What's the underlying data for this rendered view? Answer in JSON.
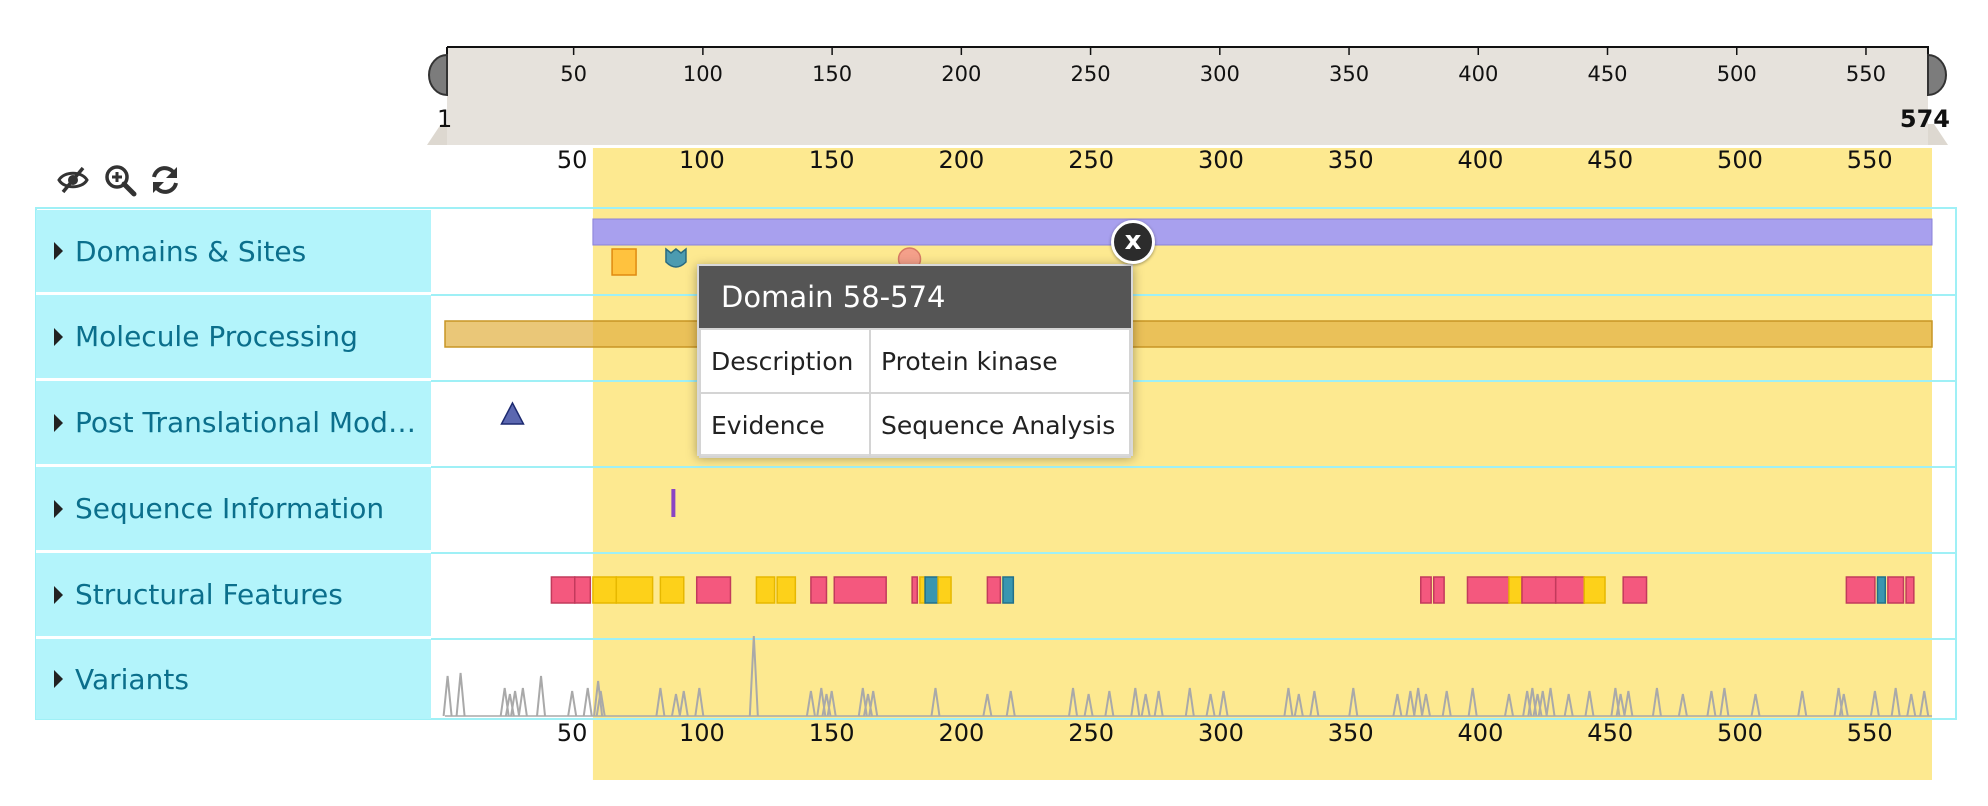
{
  "navigation": {
    "seq_length": 574,
    "start_label": "1",
    "end_label": "574",
    "tick_values": [
      50,
      100,
      150,
      200,
      250,
      300,
      350,
      400,
      450,
      500,
      550
    ],
    "zoom_range": [
      58,
      574
    ]
  },
  "toolbar": {
    "hide_icon": "eye-slash-icon",
    "zoom_icon": "zoom-in-icon",
    "reset_icon": "refresh-icon"
  },
  "categories": [
    {
      "label": "Domains & Sites"
    },
    {
      "label": "Molecule Processing"
    },
    {
      "label": "Post Translational Mod…"
    },
    {
      "label": "Sequence Information"
    },
    {
      "label": "Structural Features"
    },
    {
      "label": "Variants"
    }
  ],
  "features": {
    "domain": {
      "start": 58,
      "end": 574
    },
    "site_square": {
      "pos": 70
    },
    "site_shield": {
      "pos": 90
    },
    "site_circle": {
      "pos": 180
    },
    "chain": {
      "start": 1,
      "end": 574
    },
    "ptm_triangle": {
      "pos": 27
    },
    "seq_info_bar": {
      "pos": 89
    },
    "structural": [
      {
        "start": 42,
        "end": 51,
        "kind": "helix"
      },
      {
        "start": 51,
        "end": 57,
        "kind": "helix"
      },
      {
        "start": 58,
        "end": 67,
        "kind": "strand"
      },
      {
        "start": 67,
        "end": 81,
        "kind": "strand"
      },
      {
        "start": 84,
        "end": 93,
        "kind": "strand"
      },
      {
        "start": 98,
        "end": 111,
        "kind": "helix"
      },
      {
        "start": 121,
        "end": 128,
        "kind": "strand"
      },
      {
        "start": 129,
        "end": 136,
        "kind": "strand"
      },
      {
        "start": 142,
        "end": 148,
        "kind": "helix"
      },
      {
        "start": 151,
        "end": 171,
        "kind": "helix"
      },
      {
        "start": 181,
        "end": 183,
        "kind": "helix"
      },
      {
        "start": 184,
        "end": 186,
        "kind": "strand"
      },
      {
        "start": 186,
        "end": 191,
        "kind": "turn"
      },
      {
        "start": 191,
        "end": 196,
        "kind": "strand"
      },
      {
        "start": 210,
        "end": 215,
        "kind": "helix"
      },
      {
        "start": 216,
        "end": 220,
        "kind": "turn"
      },
      {
        "start": 377,
        "end": 381,
        "kind": "helix"
      },
      {
        "start": 382,
        "end": 386,
        "kind": "helix"
      },
      {
        "start": 395,
        "end": 411,
        "kind": "helix"
      },
      {
        "start": 411,
        "end": 416,
        "kind": "strand"
      },
      {
        "start": 416,
        "end": 429,
        "kind": "helix"
      },
      {
        "start": 429,
        "end": 440,
        "kind": "helix"
      },
      {
        "start": 440,
        "end": 448,
        "kind": "strand"
      },
      {
        "start": 455,
        "end": 464,
        "kind": "helix"
      },
      {
        "start": 541,
        "end": 552,
        "kind": "helix"
      },
      {
        "start": 553,
        "end": 556,
        "kind": "turn"
      },
      {
        "start": 557,
        "end": 563,
        "kind": "helix"
      },
      {
        "start": 564,
        "end": 567,
        "kind": "helix"
      }
    ],
    "variant_positions": [
      2,
      7,
      24,
      26,
      28,
      31,
      38,
      50,
      56,
      60,
      61,
      84,
      90,
      93,
      99,
      120,
      142,
      146,
      148,
      150,
      162,
      164,
      166,
      190,
      210,
      219,
      243,
      249,
      257,
      267,
      271,
      276,
      288,
      296,
      301,
      326,
      330,
      336,
      351,
      368,
      373,
      376,
      379,
      387,
      397,
      411,
      418,
      420,
      422,
      424,
      427,
      434,
      442,
      452,
      454,
      457,
      468,
      478,
      489,
      494,
      506,
      524,
      538,
      540,
      552,
      560,
      566,
      571
    ]
  },
  "tooltip": {
    "title": "Domain 58-574",
    "rows": [
      {
        "key": "Description",
        "value": "Protein kinase"
      },
      {
        "key": "Evidence",
        "value": "Sequence Analysis"
      }
    ],
    "close_label": "x"
  },
  "colors": {
    "category_bg": "#b3f4fb",
    "category_text": "#0b6f8c",
    "zoom_highlight": "#fde990",
    "navigator_bg": "#e6e2dc",
    "domain": "#a8a0ee",
    "chain": "#e2b244",
    "helix": "#f4587e",
    "strand": "#fdd11a",
    "turn": "#3996b0",
    "variant": "#a9a9a9",
    "ptm": "#5b67b0",
    "seq_info": "#8a45c4"
  }
}
